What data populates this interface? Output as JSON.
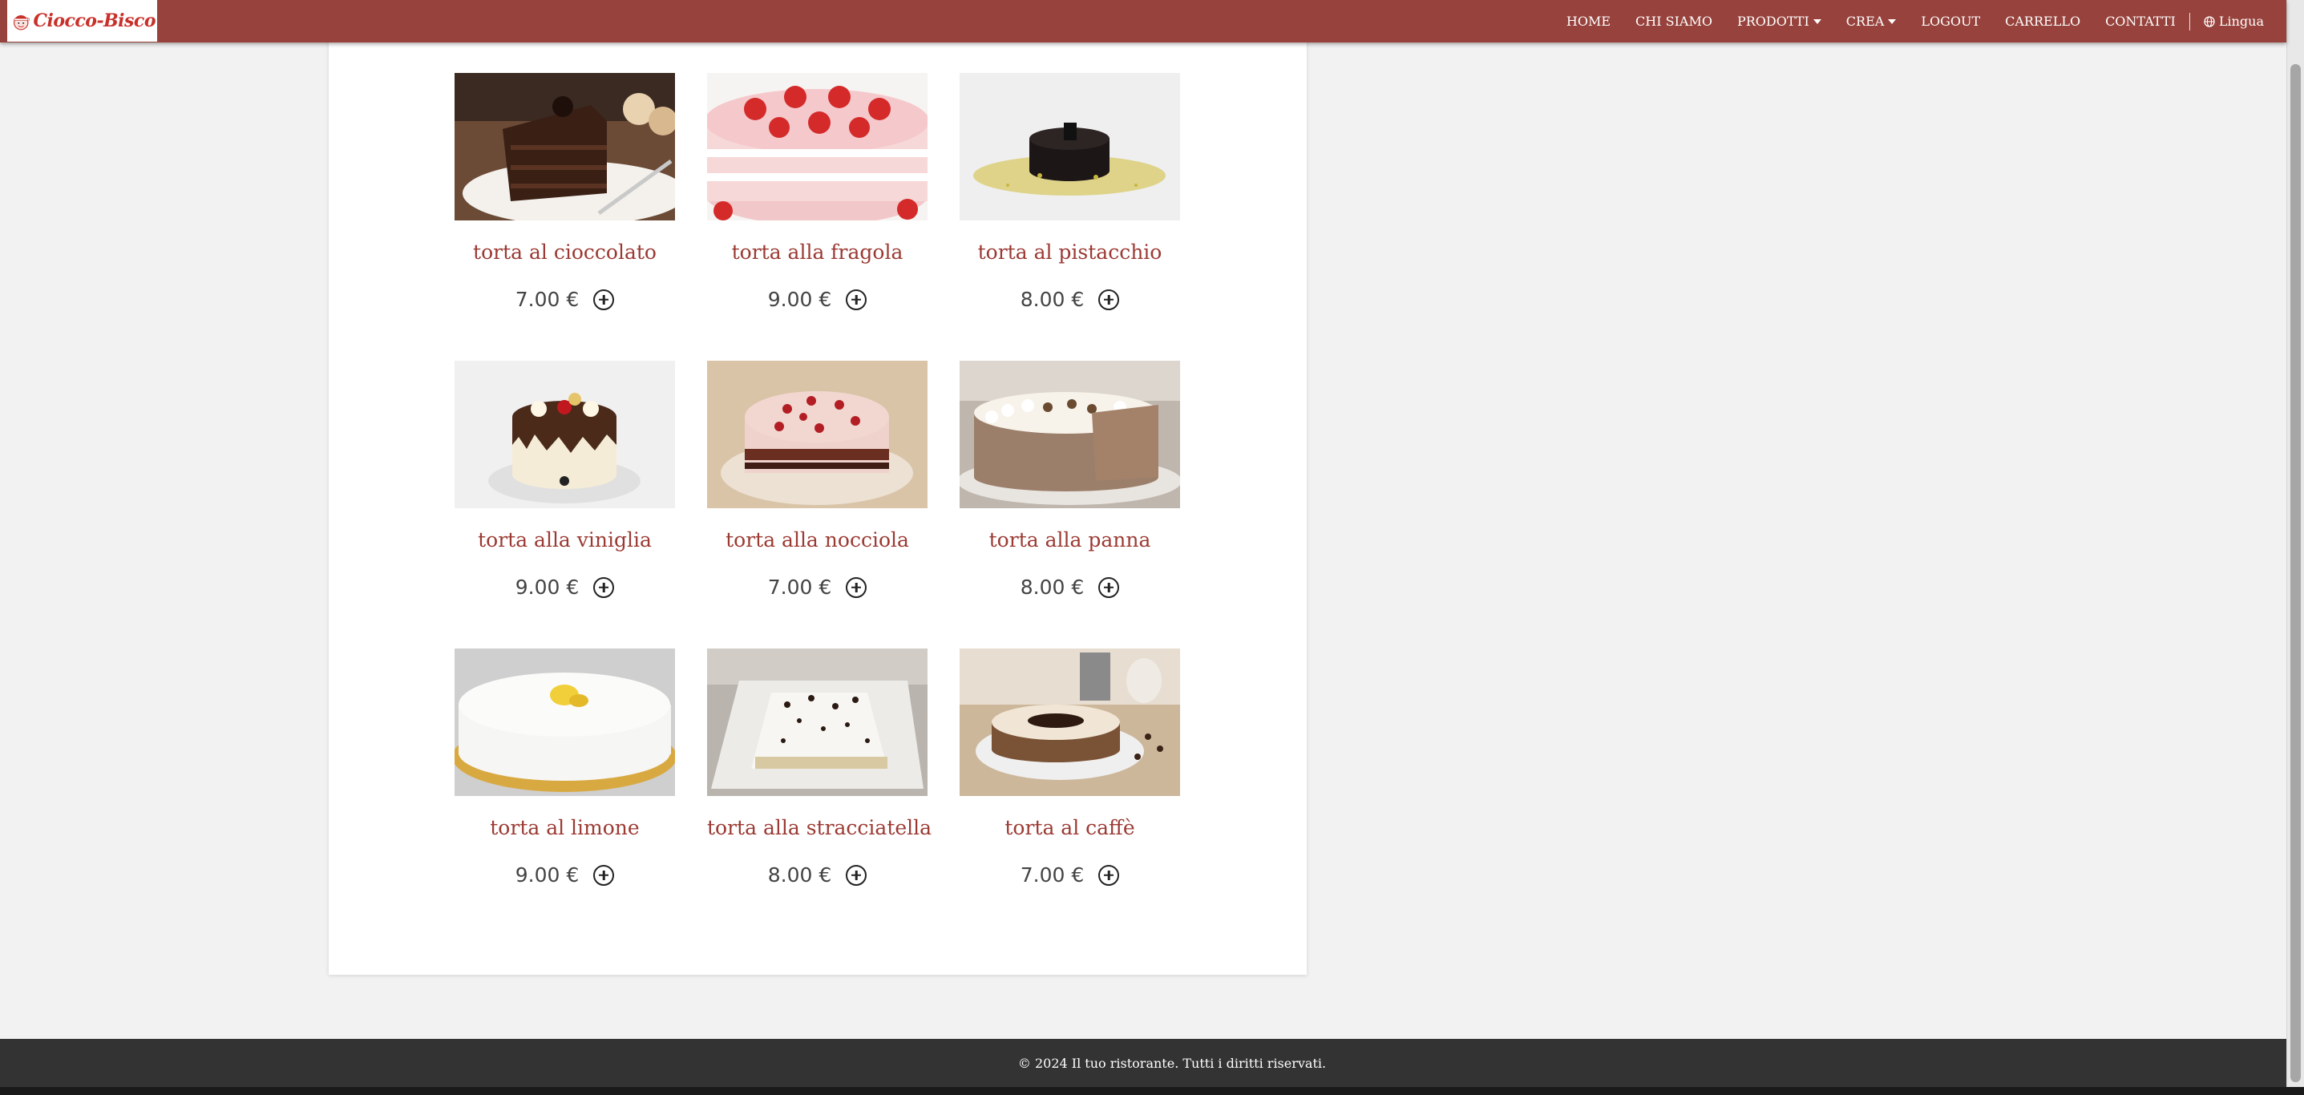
{
  "brand": {
    "logo_text": "Ciocco-Bisco",
    "primary_color": "#97423c",
    "accent_color": "#9b3a33"
  },
  "nav": {
    "items": [
      {
        "label": "HOME",
        "dropdown": false
      },
      {
        "label": "CHI SIAMO",
        "dropdown": false
      },
      {
        "label": "PRODOTTI",
        "dropdown": true
      },
      {
        "label": "CREA",
        "dropdown": true
      },
      {
        "label": "LOGOUT",
        "dropdown": false
      },
      {
        "label": "CARRELLO",
        "dropdown": false
      },
      {
        "label": "CONTATTI",
        "dropdown": false
      }
    ],
    "language_label": "Lingua"
  },
  "products": [
    {
      "name": "torta al cioccolato",
      "price": "7.00 €",
      "icon": "chocolate-cake"
    },
    {
      "name": "torta alla fragola",
      "price": "9.00 €",
      "icon": "strawberry-cake"
    },
    {
      "name": "torta al pistacchio",
      "price": "8.00 €",
      "icon": "pistachio-cake"
    },
    {
      "name": "torta alla viniglia",
      "price": "9.00 €",
      "icon": "vanilla-cake"
    },
    {
      "name": "torta alla nocciola",
      "price": "7.00 €",
      "icon": "hazelnut-cake"
    },
    {
      "name": "torta alla panna",
      "price": "8.00 €",
      "icon": "cream-cake"
    },
    {
      "name": "torta al limone",
      "price": "9.00 €",
      "icon": "lemon-cake"
    },
    {
      "name": "torta alla stracciatella",
      "price": "8.00 €",
      "icon": "stracciatella-cake"
    },
    {
      "name": "torta al caffè",
      "price": "7.00 €",
      "icon": "coffee-cake"
    }
  ],
  "footer": {
    "text": "© 2024 Il tuo ristorante. Tutti i diritti riservati.",
    "background": "#333333"
  }
}
